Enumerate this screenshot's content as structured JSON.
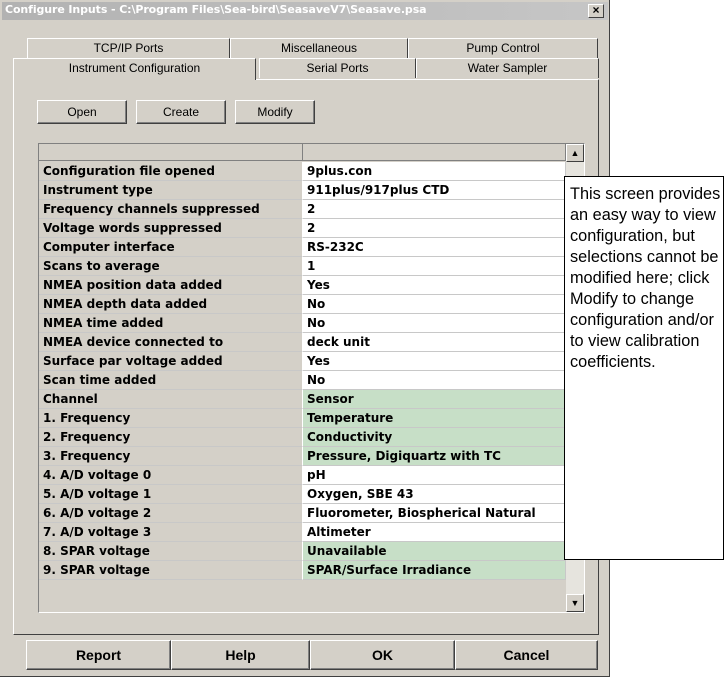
{
  "window": {
    "title": "Configure Inputs - C:\\Program Files\\Sea-bird\\SeasaveV7\\Seasave.psa",
    "close_label": "×"
  },
  "tabs": {
    "row_back": [
      "TCP/IP Ports",
      "Miscellaneous",
      "Pump Control"
    ],
    "row_front": [
      "Instrument Configuration",
      "Serial Ports",
      "Water Sampler"
    ],
    "active": "Instrument Configuration"
  },
  "buttons": {
    "open": "Open",
    "create": "Create",
    "modify": "Modify",
    "report": "Report",
    "help": "Help",
    "ok": "OK",
    "cancel": "Cancel"
  },
  "grid": {
    "rows": [
      {
        "key": "Configuration file opened",
        "value": "9plus.con",
        "highlight": false
      },
      {
        "key": "Instrument type",
        "value": "911plus/917plus CTD",
        "highlight": false
      },
      {
        "key": "Frequency channels suppressed",
        "value": "2",
        "highlight": false
      },
      {
        "key": "Voltage words suppressed",
        "value": "2",
        "highlight": false
      },
      {
        "key": "Computer interface",
        "value": "RS-232C",
        "highlight": false
      },
      {
        "key": "Scans to average",
        "value": "1",
        "highlight": false
      },
      {
        "key": "NMEA position data added",
        "value": "Yes",
        "highlight": false
      },
      {
        "key": "NMEA depth data added",
        "value": "No",
        "highlight": false
      },
      {
        "key": "NMEA time added",
        "value": "No",
        "highlight": false
      },
      {
        "key": "NMEA device connected to",
        "value": "deck unit",
        "highlight": false
      },
      {
        "key": "Surface par voltage added",
        "value": "Yes",
        "highlight": false
      },
      {
        "key": "Scan time added",
        "value": "No",
        "highlight": false
      },
      {
        "key": "Channel",
        "value": "Sensor",
        "highlight": "header"
      },
      {
        "key": "1. Frequency",
        "value": "Temperature",
        "highlight": true
      },
      {
        "key": "2. Frequency",
        "value": "Conductivity",
        "highlight": true
      },
      {
        "key": "3. Frequency",
        "value": "Pressure, Digiquartz with TC",
        "highlight": true
      },
      {
        "key": "4. A/D voltage 0",
        "value": "pH",
        "highlight": false
      },
      {
        "key": "5. A/D voltage 1",
        "value": "Oxygen, SBE 43",
        "highlight": false
      },
      {
        "key": "6. A/D voltage 2",
        "value": "Fluorometer, Biospherical Natural",
        "highlight": false
      },
      {
        "key": "7. A/D voltage 3",
        "value": "Altimeter",
        "highlight": false
      },
      {
        "key": "8. SPAR voltage",
        "value": "Unavailable",
        "highlight": true
      },
      {
        "key": "9. SPAR voltage",
        "value": "SPAR/Surface Irradiance",
        "highlight": true
      }
    ]
  },
  "callout": {
    "text": "This screen provides an easy way to view configuration, but selections cannot be modified here; click Modify to change configuration and/or to view calibration coefficients."
  },
  "colors": {
    "dialog_bg": "#d4d0c8",
    "title_bar": "#b9b9b9",
    "highlight_cell": "#c7dfc7",
    "value_cell": "#ffffff"
  }
}
